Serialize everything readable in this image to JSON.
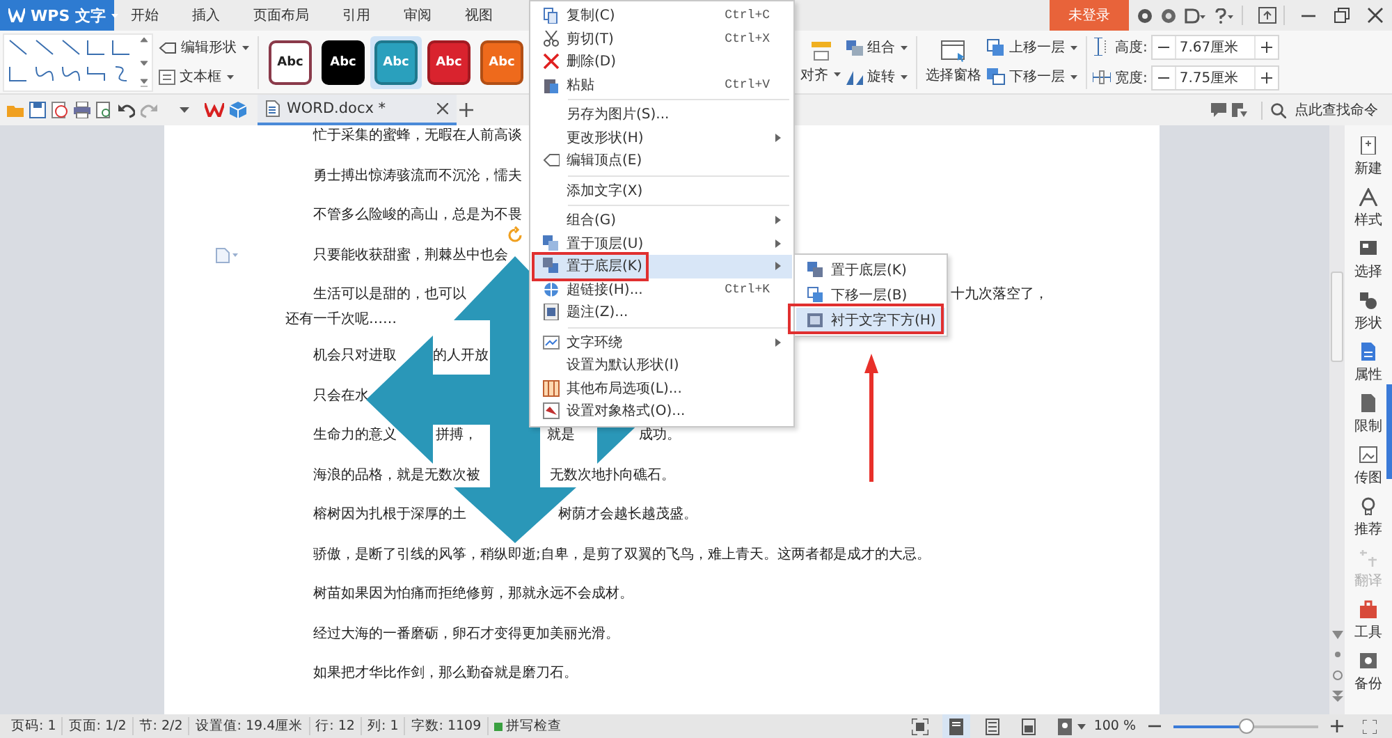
{
  "app_button": {
    "label": "WPS 文字"
  },
  "menu_tabs": [
    "开始",
    "插入",
    "页面布局",
    "引用",
    "审阅",
    "视图"
  ],
  "login_button": "未登录",
  "ribbon": {
    "edit_shape": "编辑形状",
    "text_box": "文本框",
    "styles": [
      {
        "label": "Abc",
        "color": "#ffffff",
        "selected": false
      },
      {
        "label": "Abc",
        "color": "#000000",
        "selected": false
      },
      {
        "label": "Abc",
        "color": "#2aa0bd",
        "selected": true
      },
      {
        "label": "Abc",
        "color": "#d9232e",
        "selected": false
      },
      {
        "label": "Abc",
        "color": "#ee6a1c",
        "selected": false
      }
    ],
    "align": "对齐",
    "group": "组合",
    "rotate": "旋转",
    "selection_pane": "选择窗格",
    "bring_forward": "上移一层",
    "send_backward": "下移一层",
    "height": {
      "label": "高度:",
      "value": "7.67厘米"
    },
    "width": {
      "label": "宽度:",
      "value": "7.75厘米"
    }
  },
  "doc_tab": {
    "label": "WORD.docx *"
  },
  "command_search": {
    "placeholder": "点此查找命令"
  },
  "paragraphs": [
    {
      "parts": [
        "忙于采集的蜜蜂，无暇在人前高谈"
      ]
    },
    {
      "parts": [
        "勇士搏出惊涛骇流而不沉沦，懦夫"
      ]
    },
    {
      "parts": [
        "不管多么险峻的高山，总是为不畏"
      ]
    },
    {
      "parts": [
        "只要能收获甜蜜，荆棘丛中也会"
      ]
    },
    {
      "parts": [
        "生活可以是甜的，也可以",
        "十九次落空了，"
      ],
      "wrap": "还有一千次呢……"
    },
    {
      "parts": [
        "机会只对进取",
        "的人开放"
      ]
    },
    {
      "parts": [
        "只会在水"
      ]
    },
    {
      "parts": [
        "生命力的意义",
        "拼搏，",
        "就是",
        "成功。"
      ]
    },
    {
      "parts": [
        "海浪的品格，就是无数次被",
        "无数次地扑向礁石。"
      ]
    },
    {
      "parts": [
        "榕树因为扎根于深厚的土",
        "树荫才会越长越茂盛。"
      ]
    },
    {
      "parts": [
        "骄傲，是断了引线的风筝，稍纵即逝;自卑，是剪了双翼的飞鸟，难上青天。这两者都是成才的大忌。"
      ]
    },
    {
      "parts": [
        "树苗如果因为怕痛而拒绝修剪，那就永远不会成材。"
      ]
    },
    {
      "parts": [
        "经过大海的一番磨砺，卵石才变得更加美丽光滑。"
      ]
    },
    {
      "parts": [
        "如果把才华比作剑，那么勤奋就是磨刀石。"
      ]
    }
  ],
  "context_menu": [
    {
      "kind": "item",
      "label": "复制(C)",
      "shortcut": "Ctrl+C",
      "submenu": false,
      "selected": false
    },
    {
      "kind": "item",
      "label": "剪切(T)",
      "shortcut": "Ctrl+X",
      "submenu": false,
      "selected": false
    },
    {
      "kind": "item",
      "label": "删除(D)",
      "submenu": false,
      "selected": false
    },
    {
      "kind": "item",
      "label": "粘贴",
      "shortcut": "Ctrl+V",
      "submenu": false,
      "selected": false
    },
    {
      "kind": "separator"
    },
    {
      "kind": "item",
      "label": "另存为图片(S)...",
      "submenu": false,
      "selected": false
    },
    {
      "kind": "item",
      "label": "更改形状(H)",
      "submenu": true,
      "selected": false
    },
    {
      "kind": "item",
      "label": "编辑顶点(E)",
      "submenu": false,
      "selected": false
    },
    {
      "kind": "separator"
    },
    {
      "kind": "item",
      "label": "添加文字(X)",
      "submenu": false,
      "selected": false
    },
    {
      "kind": "separator"
    },
    {
      "kind": "item",
      "label": "组合(G)",
      "submenu": true,
      "selected": false
    },
    {
      "kind": "item",
      "label": "置于顶层(U)",
      "submenu": true,
      "selected": false
    },
    {
      "kind": "item",
      "label": "置于底层(K)",
      "submenu": true,
      "selected": true
    },
    {
      "kind": "item",
      "label": "超链接(H)...",
      "shortcut": "Ctrl+K",
      "submenu": false,
      "selected": false
    },
    {
      "kind": "item",
      "label": "题注(Z)...",
      "submenu": false,
      "selected": false
    },
    {
      "kind": "separator"
    },
    {
      "kind": "item",
      "label": "文字环绕",
      "submenu": true,
      "selected": false
    },
    {
      "kind": "item",
      "label": "设置为默认形状(I)",
      "submenu": false,
      "selected": false
    },
    {
      "kind": "item",
      "label": "其他布局选项(L)...",
      "submenu": false,
      "selected": false
    },
    {
      "kind": "item",
      "label": "设置对象格式(O)...",
      "submenu": false,
      "selected": false
    }
  ],
  "submenu": [
    {
      "label": "置于底层(K)",
      "selected": false
    },
    {
      "label": "下移一层(B)",
      "selected": false
    },
    {
      "label": "衬于文字下方(H)",
      "selected": true
    }
  ],
  "sidebar": [
    {
      "label": "新建",
      "disabled": false
    },
    {
      "label": "样式",
      "disabled": false
    },
    {
      "label": "选择",
      "disabled": false
    },
    {
      "label": "形状",
      "disabled": false
    },
    {
      "label": "属性",
      "disabled": false
    },
    {
      "label": "限制",
      "disabled": false
    },
    {
      "label": "传图",
      "disabled": false
    },
    {
      "label": "推荐",
      "disabled": false
    },
    {
      "label": "翻译",
      "disabled": true
    },
    {
      "label": "工具",
      "disabled": false
    },
    {
      "label": "备份",
      "disabled": false
    }
  ],
  "status_bar": {
    "items": [
      "页码: 1",
      "页面: 1/2",
      "节: 2/2",
      "设置值: 19.4厘米",
      "行: 12",
      "列: 1",
      "字数: 1109"
    ],
    "spell_check": "拼写检查",
    "zoom": "100 %",
    "zoom_slider": {
      "level": 0.5
    }
  }
}
